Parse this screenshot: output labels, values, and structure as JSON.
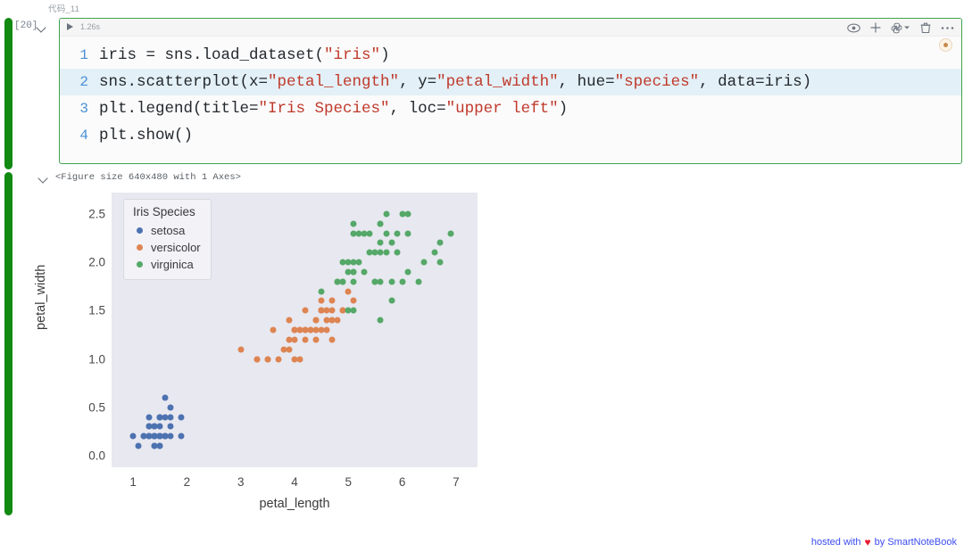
{
  "cell": {
    "tab_label": "代码_11",
    "exec_count": "[20]",
    "run_time": "1.26s",
    "toolbar": {
      "preview_icon": "eye-icon",
      "add_icon": "plus-icon",
      "env_icon": "python-env-icon",
      "env_caret": "chevron-down-icon",
      "delete_icon": "trash-icon",
      "more_icon": "ellipsis-icon"
    },
    "code_lines": [
      {
        "n": "1",
        "highlighted": false,
        "tokens": [
          {
            "t": "iris = sns.load_dataset(",
            "k": "plain"
          },
          {
            "t": "\"iris\"",
            "k": "str"
          },
          {
            "t": ")",
            "k": "plain"
          }
        ]
      },
      {
        "n": "2",
        "highlighted": true,
        "tokens": [
          {
            "t": "sns.scatterplot(x=",
            "k": "plain"
          },
          {
            "t": "\"petal_length\"",
            "k": "str"
          },
          {
            "t": ", y=",
            "k": "plain"
          },
          {
            "t": "\"petal_width\"",
            "k": "str"
          },
          {
            "t": ", hue=",
            "k": "plain"
          },
          {
            "t": "\"species\"",
            "k": "str"
          },
          {
            "t": ", data=iris)",
            "k": "plain"
          }
        ]
      },
      {
        "n": "3",
        "highlighted": false,
        "tokens": [
          {
            "t": "plt.legend(title=",
            "k": "plain"
          },
          {
            "t": "\"Iris Species\"",
            "k": "str"
          },
          {
            "t": ", loc=",
            "k": "plain"
          },
          {
            "t": "\"upper left\"",
            "k": "str"
          },
          {
            "t": ")",
            "k": "plain"
          }
        ]
      },
      {
        "n": "4",
        "highlighted": false,
        "tokens": [
          {
            "t": "plt.show()",
            "k": "plain"
          }
        ]
      }
    ]
  },
  "output": {
    "repr_text": "<Figure size 640x480 with 1 Axes>"
  },
  "footer": {
    "prefix": "hosted with",
    "heart": "♥",
    "suffix": "by SmartNoteBook"
  },
  "chart_data": {
    "type": "scatter",
    "title": "",
    "xlabel": "petal_length",
    "ylabel": "petal_width",
    "xlim": [
      0.6,
      7.4
    ],
    "ylim": [
      -0.12,
      2.72
    ],
    "xticks": [
      1,
      2,
      3,
      4,
      5,
      6,
      7
    ],
    "yticks": [
      0.0,
      0.5,
      1.0,
      1.5,
      2.0,
      2.5
    ],
    "grid": false,
    "legend": {
      "title": "Iris Species",
      "position": "upper left",
      "entries": [
        {
          "label": "setosa",
          "color": "#4c72b0"
        },
        {
          "label": "versicolor",
          "color": "#dd8452"
        },
        {
          "label": "virginica",
          "color": "#55a868"
        }
      ]
    },
    "axes_facecolor": "#e8e8f0",
    "series": [
      {
        "name": "setosa",
        "color": "#4c72b0",
        "points": [
          [
            1.4,
            0.2
          ],
          [
            1.4,
            0.2
          ],
          [
            1.3,
            0.2
          ],
          [
            1.5,
            0.2
          ],
          [
            1.4,
            0.2
          ],
          [
            1.7,
            0.4
          ],
          [
            1.4,
            0.3
          ],
          [
            1.5,
            0.2
          ],
          [
            1.4,
            0.2
          ],
          [
            1.5,
            0.1
          ],
          [
            1.5,
            0.2
          ],
          [
            1.6,
            0.2
          ],
          [
            1.4,
            0.1
          ],
          [
            1.1,
            0.1
          ],
          [
            1.2,
            0.2
          ],
          [
            1.5,
            0.4
          ],
          [
            1.3,
            0.4
          ],
          [
            1.4,
            0.3
          ],
          [
            1.7,
            0.3
          ],
          [
            1.5,
            0.3
          ],
          [
            1.7,
            0.2
          ],
          [
            1.5,
            0.4
          ],
          [
            1.0,
            0.2
          ],
          [
            1.7,
            0.5
          ],
          [
            1.9,
            0.2
          ],
          [
            1.6,
            0.2
          ],
          [
            1.6,
            0.4
          ],
          [
            1.5,
            0.2
          ],
          [
            1.4,
            0.2
          ],
          [
            1.6,
            0.2
          ],
          [
            1.6,
            0.2
          ],
          [
            1.5,
            0.4
          ],
          [
            1.5,
            0.1
          ],
          [
            1.4,
            0.2
          ],
          [
            1.5,
            0.2
          ],
          [
            1.2,
            0.2
          ],
          [
            1.3,
            0.2
          ],
          [
            1.4,
            0.1
          ],
          [
            1.3,
            0.2
          ],
          [
            1.5,
            0.2
          ],
          [
            1.3,
            0.3
          ],
          [
            1.3,
            0.3
          ],
          [
            1.3,
            0.2
          ],
          [
            1.6,
            0.6
          ],
          [
            1.9,
            0.4
          ],
          [
            1.4,
            0.3
          ],
          [
            1.6,
            0.2
          ],
          [
            1.4,
            0.2
          ],
          [
            1.5,
            0.2
          ],
          [
            1.4,
            0.2
          ]
        ]
      },
      {
        "name": "versicolor",
        "color": "#dd8452",
        "points": [
          [
            4.7,
            1.4
          ],
          [
            4.5,
            1.5
          ],
          [
            4.9,
            1.5
          ],
          [
            4.0,
            1.3
          ],
          [
            4.6,
            1.5
          ],
          [
            4.5,
            1.3
          ],
          [
            4.7,
            1.6
          ],
          [
            3.3,
            1.0
          ],
          [
            4.6,
            1.3
          ],
          [
            3.9,
            1.4
          ],
          [
            3.5,
            1.0
          ],
          [
            4.2,
            1.5
          ],
          [
            4.0,
            1.0
          ],
          [
            4.7,
            1.4
          ],
          [
            3.6,
            1.3
          ],
          [
            4.4,
            1.4
          ],
          [
            4.5,
            1.5
          ],
          [
            4.1,
            1.0
          ],
          [
            4.5,
            1.5
          ],
          [
            3.9,
            1.1
          ],
          [
            4.8,
            1.8
          ],
          [
            4.0,
            1.3
          ],
          [
            4.9,
            1.5
          ],
          [
            4.7,
            1.2
          ],
          [
            4.3,
            1.3
          ],
          [
            4.4,
            1.4
          ],
          [
            4.8,
            1.4
          ],
          [
            5.0,
            1.7
          ],
          [
            4.5,
            1.5
          ],
          [
            3.5,
            1.0
          ],
          [
            3.8,
            1.1
          ],
          [
            3.7,
            1.0
          ],
          [
            3.9,
            1.2
          ],
          [
            5.1,
            1.6
          ],
          [
            4.5,
            1.5
          ],
          [
            4.5,
            1.6
          ],
          [
            4.7,
            1.5
          ],
          [
            4.4,
            1.3
          ],
          [
            4.1,
            1.3
          ],
          [
            4.0,
            1.3
          ],
          [
            4.4,
            1.2
          ],
          [
            4.6,
            1.4
          ],
          [
            4.0,
            1.2
          ],
          [
            3.3,
            1.0
          ],
          [
            4.2,
            1.3
          ],
          [
            4.2,
            1.2
          ],
          [
            4.2,
            1.3
          ],
          [
            4.3,
            1.3
          ],
          [
            3.0,
            1.1
          ],
          [
            4.1,
            1.3
          ]
        ]
      },
      {
        "name": "virginica",
        "color": "#55a868",
        "points": [
          [
            6.0,
            2.5
          ],
          [
            5.1,
            1.9
          ],
          [
            5.9,
            2.1
          ],
          [
            5.6,
            1.8
          ],
          [
            5.8,
            2.2
          ],
          [
            6.6,
            2.1
          ],
          [
            4.5,
            1.7
          ],
          [
            6.3,
            1.8
          ],
          [
            5.8,
            1.8
          ],
          [
            6.1,
            2.5
          ],
          [
            5.1,
            2.0
          ],
          [
            5.3,
            1.9
          ],
          [
            5.5,
            2.1
          ],
          [
            5.0,
            2.0
          ],
          [
            5.1,
            2.4
          ],
          [
            5.3,
            2.3
          ],
          [
            5.5,
            1.8
          ],
          [
            6.7,
            2.2
          ],
          [
            6.9,
            2.3
          ],
          [
            5.0,
            1.5
          ],
          [
            5.7,
            2.3
          ],
          [
            4.9,
            2.0
          ],
          [
            6.7,
            2.0
          ],
          [
            4.9,
            1.8
          ],
          [
            5.7,
            2.1
          ],
          [
            6.0,
            1.8
          ],
          [
            4.8,
            1.8
          ],
          [
            4.9,
            1.8
          ],
          [
            5.6,
            2.1
          ],
          [
            5.8,
            1.6
          ],
          [
            6.1,
            1.9
          ],
          [
            6.4,
            2.0
          ],
          [
            5.6,
            2.2
          ],
          [
            5.1,
            1.5
          ],
          [
            5.6,
            1.4
          ],
          [
            6.1,
            2.3
          ],
          [
            5.6,
            2.4
          ],
          [
            5.5,
            1.8
          ],
          [
            4.8,
            1.8
          ],
          [
            5.4,
            2.1
          ],
          [
            5.6,
            2.4
          ],
          [
            5.1,
            2.3
          ],
          [
            5.1,
            1.9
          ],
          [
            5.9,
            2.3
          ],
          [
            5.7,
            2.5
          ],
          [
            5.2,
            2.3
          ],
          [
            5.0,
            1.9
          ],
          [
            5.2,
            2.0
          ],
          [
            5.4,
            2.3
          ],
          [
            5.1,
            1.8
          ]
        ]
      }
    ]
  }
}
